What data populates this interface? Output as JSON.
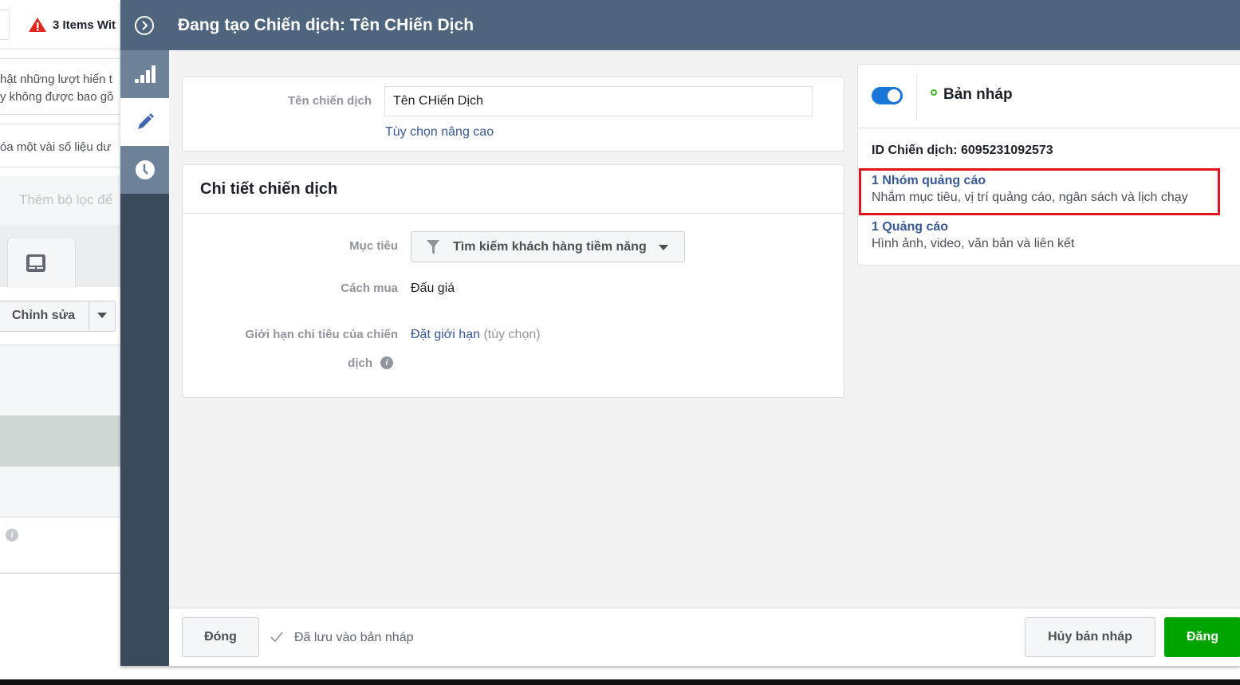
{
  "background": {
    "warning_text": "3 Items Wit",
    "line1": "hật những lượt hiển t",
    "line2": "y không được bao gồ",
    "line3": "óa một vài số liệu dư",
    "filter_placeholder": "Thêm bộ lọc để",
    "edit_label": "Chỉnh sửa"
  },
  "header": {
    "title": "Đang tạo Chiến dịch: Tên CHiến Dịch"
  },
  "name_card": {
    "label": "Tên chiến dịch",
    "value": "Tên CHiến Dịch",
    "advanced_link": "Tùy chọn nâng cao"
  },
  "details": {
    "title": "Chi tiết chiến dịch",
    "objective_label": "Mục tiêu",
    "objective_value": "Tìm kiếm khách hàng tiềm năng",
    "buying_label": "Cách mua",
    "buying_value": "Đấu giá",
    "limit_label_1": "Giới hạn chi tiêu của chiến",
    "limit_label_2": "dịch",
    "limit_link": "Đặt giới hạn",
    "limit_optional": "(tùy chọn)"
  },
  "status": {
    "toggle_on": true,
    "label": "Bản nháp",
    "campaign_id": "ID Chiến dịch: 6095231092573",
    "adset_title": "1 Nhóm quảng cáo",
    "adset_desc": "Nhắm mục tiêu, vị trí quảng cáo, ngân sách và lịch chạy",
    "ad_title": "1 Quảng cáo",
    "ad_desc": "Hình ảnh, video, văn bản và liên kết",
    "highlight_color": "#e0141e"
  },
  "footer": {
    "close": "Đóng",
    "saved": "Đã lưu vào bản nháp",
    "discard": "Hủy bản nháp",
    "publish": "Đăng",
    "publish_color": "#00a400"
  }
}
